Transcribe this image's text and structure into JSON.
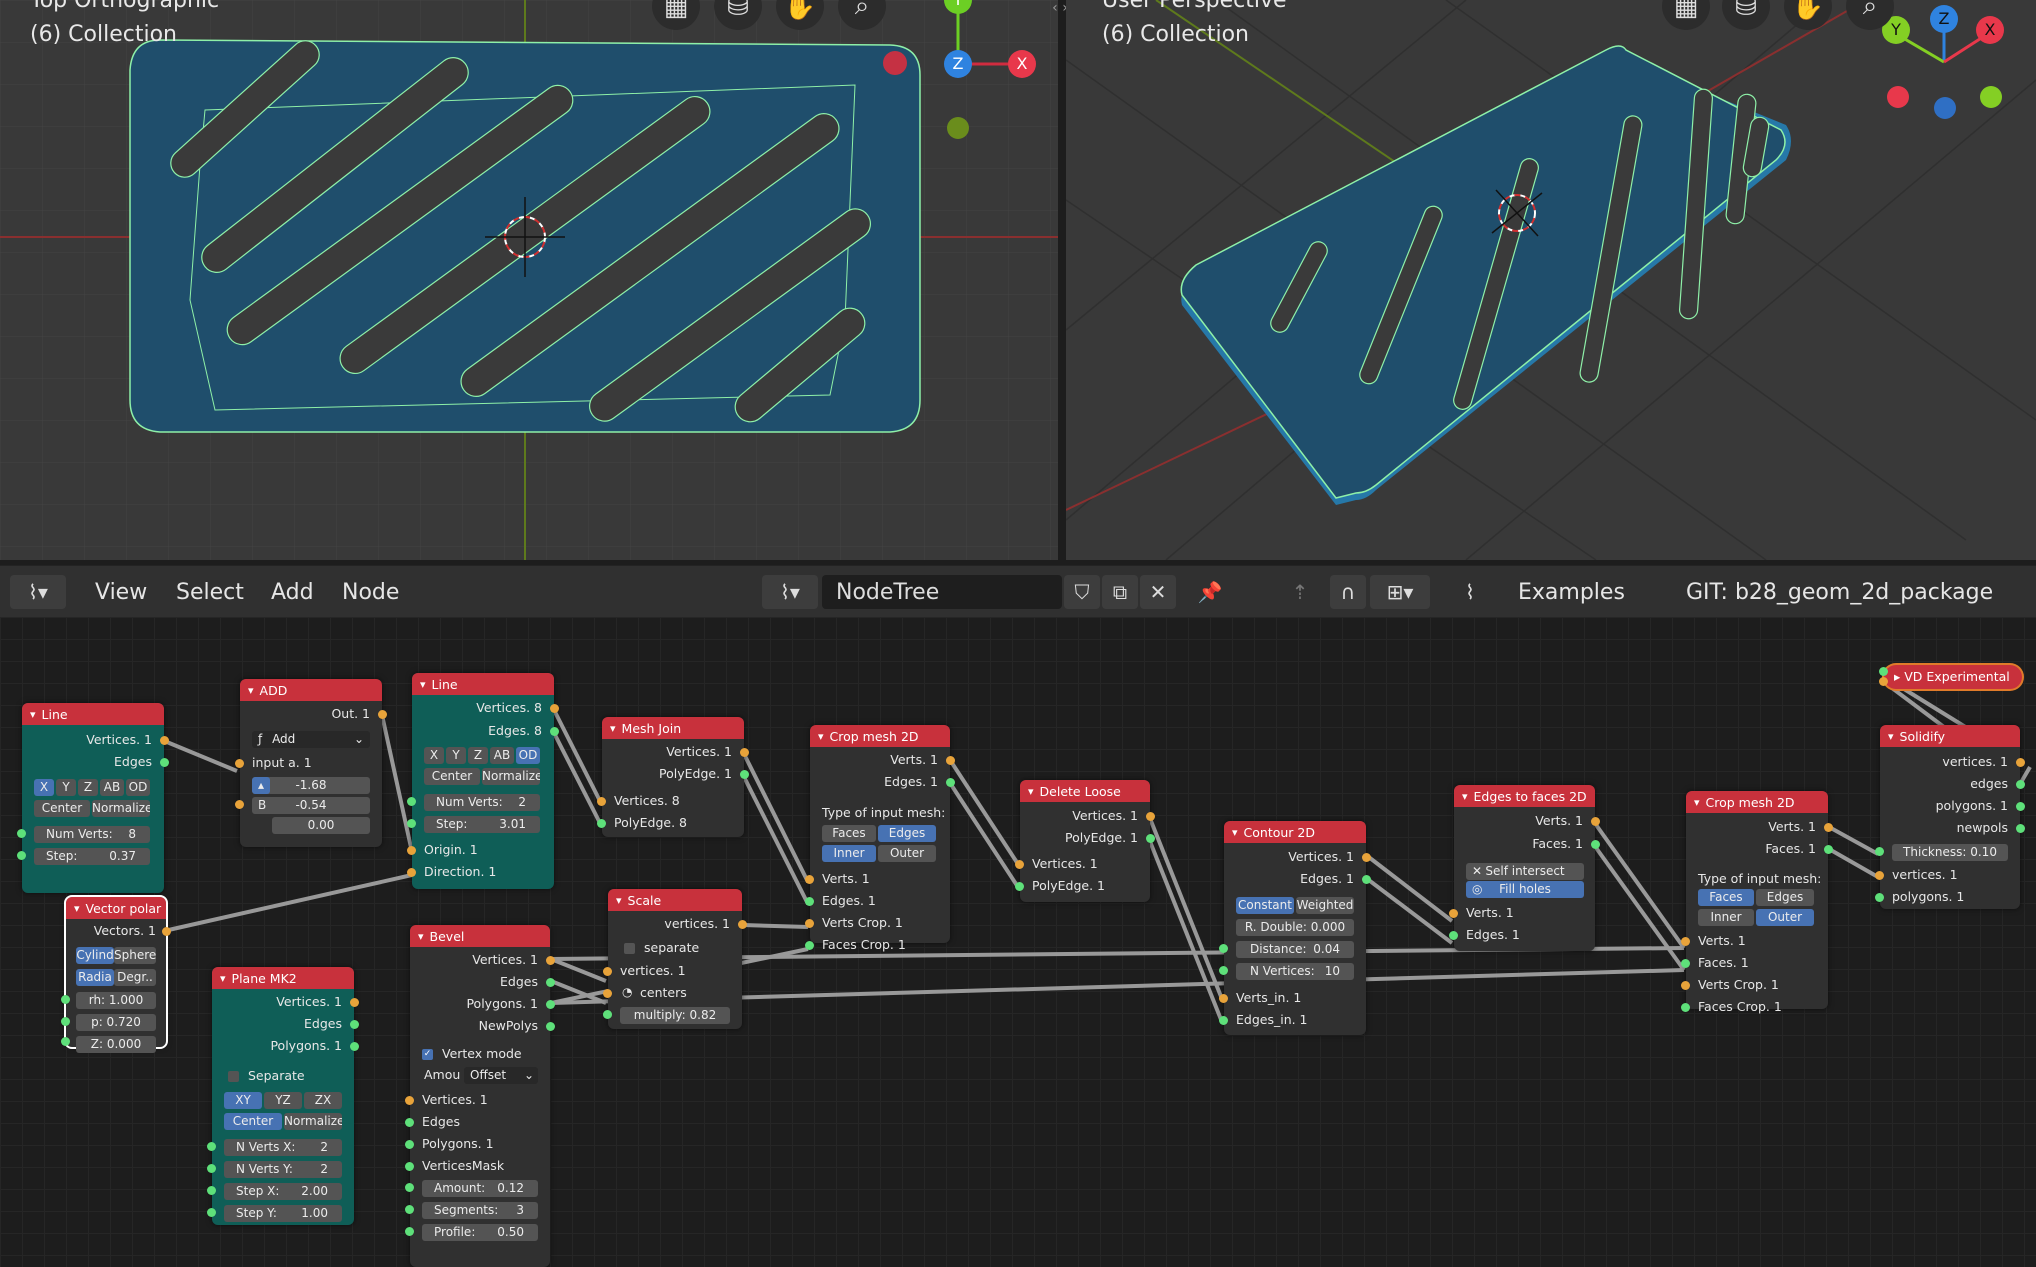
{
  "viewport_left": {
    "title": "Top Orthographic",
    "subtitle": "(6) Collection",
    "gizmo": {
      "top": "Y",
      "center": "Z",
      "right": "X"
    }
  },
  "viewport_right": {
    "title": "User Perspective",
    "subtitle": "(6) Collection",
    "gizmo": {
      "y": "Y",
      "z": "Z",
      "x": "X"
    }
  },
  "viewport_tools": [
    "grid-icon",
    "camera-icon",
    "hand-icon",
    "zoom-icon"
  ],
  "header": {
    "menus": [
      "View",
      "Select",
      "Add",
      "Node"
    ],
    "tree_name": "NodeTree",
    "examples": "Examples",
    "git": "GIT: b28_geom_2d_package"
  },
  "nodes": {
    "line1": {
      "title": "Line",
      "out": [
        "Vertices. 1",
        "Edges"
      ],
      "axes": [
        "X",
        "Y",
        "Z",
        "AB",
        "OD"
      ],
      "center": "Center",
      "normalize": "Normalize",
      "numverts": "Num Verts:",
      "numverts_v": "8",
      "step": "Step:",
      "step_v": "0.37"
    },
    "add": {
      "title": "ADD",
      "out": "Out. 1",
      "op": "Add",
      "in_a": "input a. 1",
      "a_val": "-1.68",
      "b_label": "B",
      "b_val": "-0.54",
      "c_val": "0.00"
    },
    "line2": {
      "title": "Line",
      "out": [
        "Vertices. 8",
        "Edges. 8"
      ],
      "axes": [
        "X",
        "Y",
        "Z",
        "AB",
        "OD"
      ],
      "center": "Center",
      "normalize": "Normalize",
      "numverts": "Num Verts:",
      "numverts_v": "2",
      "step": "Step:",
      "step_v": "3.01",
      "in": [
        "Origin. 1",
        "Direction. 1"
      ]
    },
    "meshjoin": {
      "title": "Mesh Join",
      "out": [
        "Vertices. 1",
        "PolyEdge. 1"
      ],
      "in": [
        "Vertices. 8",
        "PolyEdge. 8"
      ]
    },
    "crop1": {
      "title": "Crop mesh 2D",
      "out": [
        "Verts. 1",
        "Edges. 1"
      ],
      "type_label": "Type of input mesh:",
      "opt": [
        "Faces",
        "Edges",
        "Inner",
        "Outer"
      ],
      "in": [
        "Verts. 1",
        "Edges. 1",
        "Verts Crop. 1",
        "Faces Crop. 1"
      ]
    },
    "delloose": {
      "title": "Delete Loose",
      "out": [
        "Vertices. 1",
        "PolyEdge. 1"
      ],
      "in": [
        "Vertices. 1",
        "PolyEdge. 1"
      ]
    },
    "contour": {
      "title": "Contour 2D",
      "out": [
        "Vertices. 1",
        "Edges. 1"
      ],
      "mode": [
        "Constant",
        "Weighted"
      ],
      "rdouble": "R. Double: 0.000",
      "distance": "Distance:",
      "distance_v": "0.04",
      "nvert": "N Vertices:",
      "nvert_v": "10",
      "in": [
        "Verts_in. 1",
        "Edges_in. 1"
      ]
    },
    "e2f": {
      "title": "Edges to faces 2D",
      "out": [
        "Verts. 1",
        "Faces. 1"
      ],
      "self": "Self intersect",
      "fill": "Fill holes",
      "in": [
        "Verts. 1",
        "Edges. 1"
      ]
    },
    "crop2": {
      "title": "Crop mesh 2D",
      "out": [
        "Verts. 1",
        "Faces. 1"
      ],
      "type_label": "Type of input mesh:",
      "opt": [
        "Faces",
        "Edges",
        "Inner",
        "Outer"
      ],
      "in": [
        "Verts. 1",
        "Faces. 1",
        "Verts Crop. 1",
        "Faces Crop. 1"
      ]
    },
    "vd": {
      "title": "VD Experimental"
    },
    "solidify": {
      "title": "Solidify",
      "out": [
        "vertices. 1",
        "edges",
        "polygons. 1",
        "newpols"
      ],
      "thick": "Thickness:",
      "thick_v": "0.10",
      "in": [
        "vertices. 1",
        "polygons. 1"
      ]
    },
    "vpolar": {
      "title": "Vector polar ..",
      "out": "Vectors. 1",
      "a": [
        "Cylind",
        "Sphere"
      ],
      "b": [
        "Radia",
        "Degr.."
      ],
      "rh": "rh: 1.000",
      "p": "p:  0.720",
      "z": "Z:  0.000"
    },
    "scale": {
      "title": "Scale",
      "out": "vertices. 1",
      "sep": "separate",
      "in": [
        "vertices. 1",
        "centers"
      ],
      "mult": "multiply:",
      "mult_v": "0.82"
    },
    "plane": {
      "title": "Plane MK2",
      "out": [
        "Vertices. 1",
        "Edges",
        "Polygons. 1"
      ],
      "sep": "Separate",
      "planes": [
        "XY",
        "YZ",
        "ZX"
      ],
      "center": "Center",
      "normalize": "Normalize",
      "nvx": "N Verts X:",
      "nvx_v": "2",
      "nvy": "N Verts Y:",
      "nvy_v": "2",
      "sx": "Step X:",
      "sx_v": "2.00",
      "sy": "Step Y:",
      "sy_v": "1.00"
    },
    "bevel": {
      "title": "Bevel",
      "out": [
        "Vertices. 1",
        "Edges",
        "Polygons. 1",
        "NewPolys"
      ],
      "vmode": "Vertex mode",
      "amou": "Amou",
      "amou_v": "Offset",
      "in": [
        "Vertices. 1",
        "Edges",
        "Polygons. 1",
        "VerticesMask"
      ],
      "amount": "Amount:",
      "amount_v": "0.12",
      "seg": "Segments:",
      "seg_v": "3",
      "prof": "Profile:",
      "prof_v": "0.50"
    }
  },
  "colors": {
    "accent_blue": "#4772b3",
    "node_header": "#c8313c",
    "teal_node": "#0f5e57",
    "mesh_fill": "#1f4e6c",
    "edge": "#8ef0a8"
  }
}
